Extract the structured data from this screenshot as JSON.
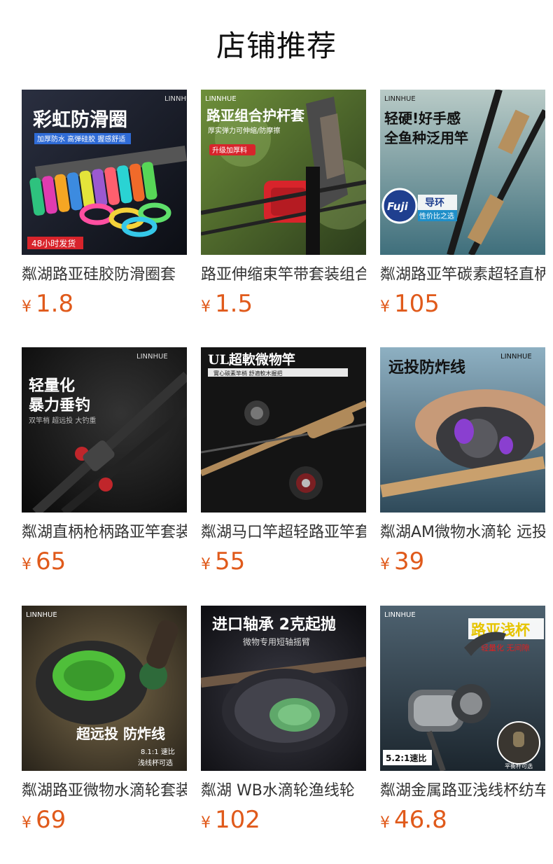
{
  "header": {
    "title": "店铺推荐"
  },
  "currency": "¥",
  "products": [
    {
      "name": "粼湖路亚硅胶防滑圈套",
      "price": "1.8",
      "image": {
        "brand": "LINNHUE",
        "headline": "彩虹防滑圈",
        "subline": "加厚防水 高弹硅胶 握感舒适",
        "badge": "48小时发货",
        "bg": "#1b1e2a",
        "accent": "#2f6bd6"
      }
    },
    {
      "name": "路亚伸缩束竿带套装组合",
      "price": "1.5",
      "image": {
        "brand": "LINNHUE",
        "headline": "路亚组合护杆套",
        "subline": "厚实弹力可伸缩/防摩擦",
        "badge": "升级加厚料",
        "bg": "#4a6a2a",
        "accent": "#d8242b"
      }
    },
    {
      "name": "粼湖路亚竿碳素超轻直柄",
      "price": "105",
      "image": {
        "brand": "LINNHUE",
        "headline": "轻硬!好手感",
        "subline": "全鱼种泛用竿",
        "badge": "导环",
        "badge2": "性价比之选",
        "logo": "Fuji",
        "bg": "#6f9aa3",
        "accent": "#1f3f8f"
      }
    },
    {
      "name": "粼湖直柄枪柄路亚竿套装",
      "price": "65",
      "image": {
        "brand": "LINNHUE",
        "headline": "轻量化",
        "headline2": "暴力垂钓",
        "subline": "双竿梢 超远投 大钓重",
        "bg": "#151515",
        "accent": "#c0262b"
      }
    },
    {
      "name": "粼湖马口竿超轻路亚竿套装",
      "price": "55",
      "image": {
        "headline": "UL超軟微物竿",
        "subline": "實心碳素竿梢 舒適軟木握把",
        "bg": "#141414",
        "accent": "#b08a5a"
      }
    },
    {
      "name": "粼湖AM微物水滴轮 远投",
      "price": "39",
      "image": {
        "brand": "LINNHUE",
        "headline": "远投防炸线",
        "bg": "#5a7f95",
        "accent": "#8a3fd0"
      }
    },
    {
      "name": "粼湖路亚微物水滴轮套装",
      "price": "69",
      "image": {
        "brand": "LINNHUE",
        "headline": "超远投 防炸线",
        "subline": "8.1:1 速比",
        "subline2": "浅线杯可选",
        "bg": "#3a3024",
        "accent": "#4fbf3a"
      }
    },
    {
      "name": "粼湖 WB水滴轮渔线轮",
      "price": "102",
      "image": {
        "headline": "进口轴承 2克起抛",
        "subline": "微物专用短轴摇臂",
        "bg": "#1e1e24",
        "accent": "#5fa86a"
      }
    },
    {
      "name": "粼湖金属路亚浅线杯纺车轮",
      "price": "46.8",
      "image": {
        "brand": "LINNHUE",
        "headline": "路亚浅杯",
        "subline": "轻量化 无间隙",
        "badge": "5.2:1速比",
        "badge2": "平衡杆可选",
        "bg": "#2e3d48",
        "accent": "#f5e200"
      }
    }
  ]
}
